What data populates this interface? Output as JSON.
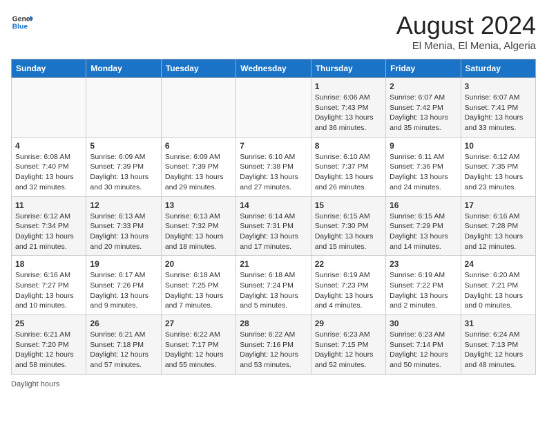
{
  "logo": {
    "line1": "General",
    "line2": "Blue"
  },
  "title": "August 2024",
  "subtitle": "El Menia, El Menia, Algeria",
  "days_of_week": [
    "Sunday",
    "Monday",
    "Tuesday",
    "Wednesday",
    "Thursday",
    "Friday",
    "Saturday"
  ],
  "weeks": [
    [
      {
        "day": "",
        "info": ""
      },
      {
        "day": "",
        "info": ""
      },
      {
        "day": "",
        "info": ""
      },
      {
        "day": "",
        "info": ""
      },
      {
        "day": "1",
        "info": "Sunrise: 6:06 AM\nSunset: 7:43 PM\nDaylight: 13 hours and 36 minutes."
      },
      {
        "day": "2",
        "info": "Sunrise: 6:07 AM\nSunset: 7:42 PM\nDaylight: 13 hours and 35 minutes."
      },
      {
        "day": "3",
        "info": "Sunrise: 6:07 AM\nSunset: 7:41 PM\nDaylight: 13 hours and 33 minutes."
      }
    ],
    [
      {
        "day": "4",
        "info": "Sunrise: 6:08 AM\nSunset: 7:40 PM\nDaylight: 13 hours and 32 minutes."
      },
      {
        "day": "5",
        "info": "Sunrise: 6:09 AM\nSunset: 7:39 PM\nDaylight: 13 hours and 30 minutes."
      },
      {
        "day": "6",
        "info": "Sunrise: 6:09 AM\nSunset: 7:39 PM\nDaylight: 13 hours and 29 minutes."
      },
      {
        "day": "7",
        "info": "Sunrise: 6:10 AM\nSunset: 7:38 PM\nDaylight: 13 hours and 27 minutes."
      },
      {
        "day": "8",
        "info": "Sunrise: 6:10 AM\nSunset: 7:37 PM\nDaylight: 13 hours and 26 minutes."
      },
      {
        "day": "9",
        "info": "Sunrise: 6:11 AM\nSunset: 7:36 PM\nDaylight: 13 hours and 24 minutes."
      },
      {
        "day": "10",
        "info": "Sunrise: 6:12 AM\nSunset: 7:35 PM\nDaylight: 13 hours and 23 minutes."
      }
    ],
    [
      {
        "day": "11",
        "info": "Sunrise: 6:12 AM\nSunset: 7:34 PM\nDaylight: 13 hours and 21 minutes."
      },
      {
        "day": "12",
        "info": "Sunrise: 6:13 AM\nSunset: 7:33 PM\nDaylight: 13 hours and 20 minutes."
      },
      {
        "day": "13",
        "info": "Sunrise: 6:13 AM\nSunset: 7:32 PM\nDaylight: 13 hours and 18 minutes."
      },
      {
        "day": "14",
        "info": "Sunrise: 6:14 AM\nSunset: 7:31 PM\nDaylight: 13 hours and 17 minutes."
      },
      {
        "day": "15",
        "info": "Sunrise: 6:15 AM\nSunset: 7:30 PM\nDaylight: 13 hours and 15 minutes."
      },
      {
        "day": "16",
        "info": "Sunrise: 6:15 AM\nSunset: 7:29 PM\nDaylight: 13 hours and 14 minutes."
      },
      {
        "day": "17",
        "info": "Sunrise: 6:16 AM\nSunset: 7:28 PM\nDaylight: 13 hours and 12 minutes."
      }
    ],
    [
      {
        "day": "18",
        "info": "Sunrise: 6:16 AM\nSunset: 7:27 PM\nDaylight: 13 hours and 10 minutes."
      },
      {
        "day": "19",
        "info": "Sunrise: 6:17 AM\nSunset: 7:26 PM\nDaylight: 13 hours and 9 minutes."
      },
      {
        "day": "20",
        "info": "Sunrise: 6:18 AM\nSunset: 7:25 PM\nDaylight: 13 hours and 7 minutes."
      },
      {
        "day": "21",
        "info": "Sunrise: 6:18 AM\nSunset: 7:24 PM\nDaylight: 13 hours and 5 minutes."
      },
      {
        "day": "22",
        "info": "Sunrise: 6:19 AM\nSunset: 7:23 PM\nDaylight: 13 hours and 4 minutes."
      },
      {
        "day": "23",
        "info": "Sunrise: 6:19 AM\nSunset: 7:22 PM\nDaylight: 13 hours and 2 minutes."
      },
      {
        "day": "24",
        "info": "Sunrise: 6:20 AM\nSunset: 7:21 PM\nDaylight: 13 hours and 0 minutes."
      }
    ],
    [
      {
        "day": "25",
        "info": "Sunrise: 6:21 AM\nSunset: 7:20 PM\nDaylight: 12 hours and 58 minutes."
      },
      {
        "day": "26",
        "info": "Sunrise: 6:21 AM\nSunset: 7:18 PM\nDaylight: 12 hours and 57 minutes."
      },
      {
        "day": "27",
        "info": "Sunrise: 6:22 AM\nSunset: 7:17 PM\nDaylight: 12 hours and 55 minutes."
      },
      {
        "day": "28",
        "info": "Sunrise: 6:22 AM\nSunset: 7:16 PM\nDaylight: 12 hours and 53 minutes."
      },
      {
        "day": "29",
        "info": "Sunrise: 6:23 AM\nSunset: 7:15 PM\nDaylight: 12 hours and 52 minutes."
      },
      {
        "day": "30",
        "info": "Sunrise: 6:23 AM\nSunset: 7:14 PM\nDaylight: 12 hours and 50 minutes."
      },
      {
        "day": "31",
        "info": "Sunrise: 6:24 AM\nSunset: 7:13 PM\nDaylight: 12 hours and 48 minutes."
      }
    ]
  ],
  "footer": "Daylight hours"
}
